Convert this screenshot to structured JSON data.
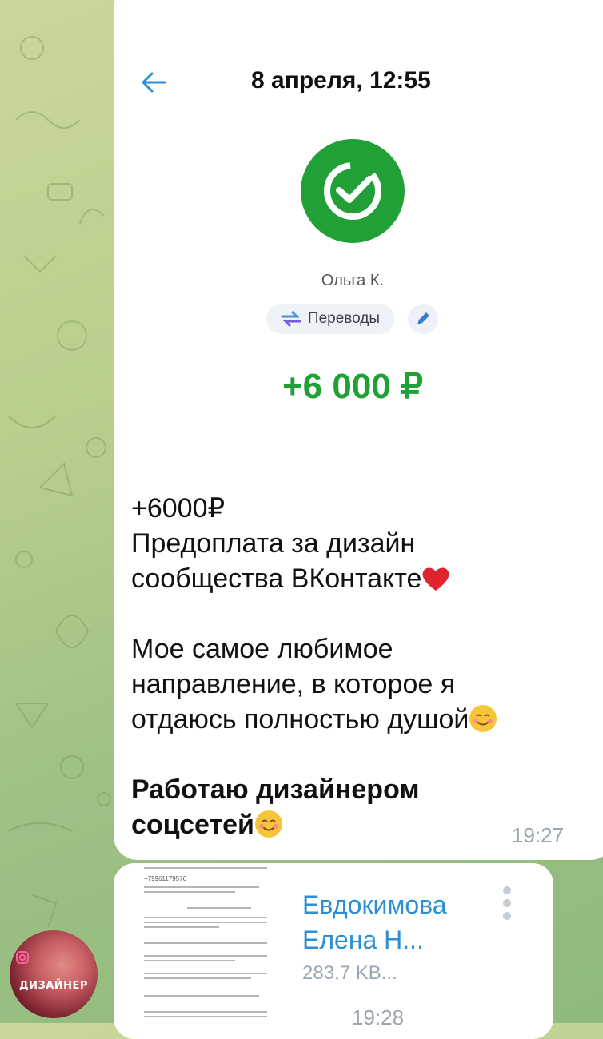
{
  "header": {
    "date": "8 апреля, 12:55"
  },
  "payment": {
    "sender": "Ольга К.",
    "category": "Переводы",
    "amount": "+6 000 ₽"
  },
  "message": {
    "lines": [
      "+6000₽",
      "Предоплата за дизайн",
      "сообщества ВКонтакте",
      "Мое самое любимое",
      "направление, в которое я",
      "отдаюсь полностью душой",
      "Работаю дизайнером",
      "соцсетей"
    ],
    "time": "19:27"
  },
  "file": {
    "name_line1": "Евдокимова",
    "name_line2": "Елена Н...",
    "size": "283,7 KB...",
    "time": "19:28",
    "thumb_text": "+79961179576"
  },
  "avatar": {
    "label": "ДИЗАЙНЕР"
  },
  "colors": {
    "accent": "#21a038",
    "link": "#2a8fd4",
    "time": "#9aa6b2"
  }
}
